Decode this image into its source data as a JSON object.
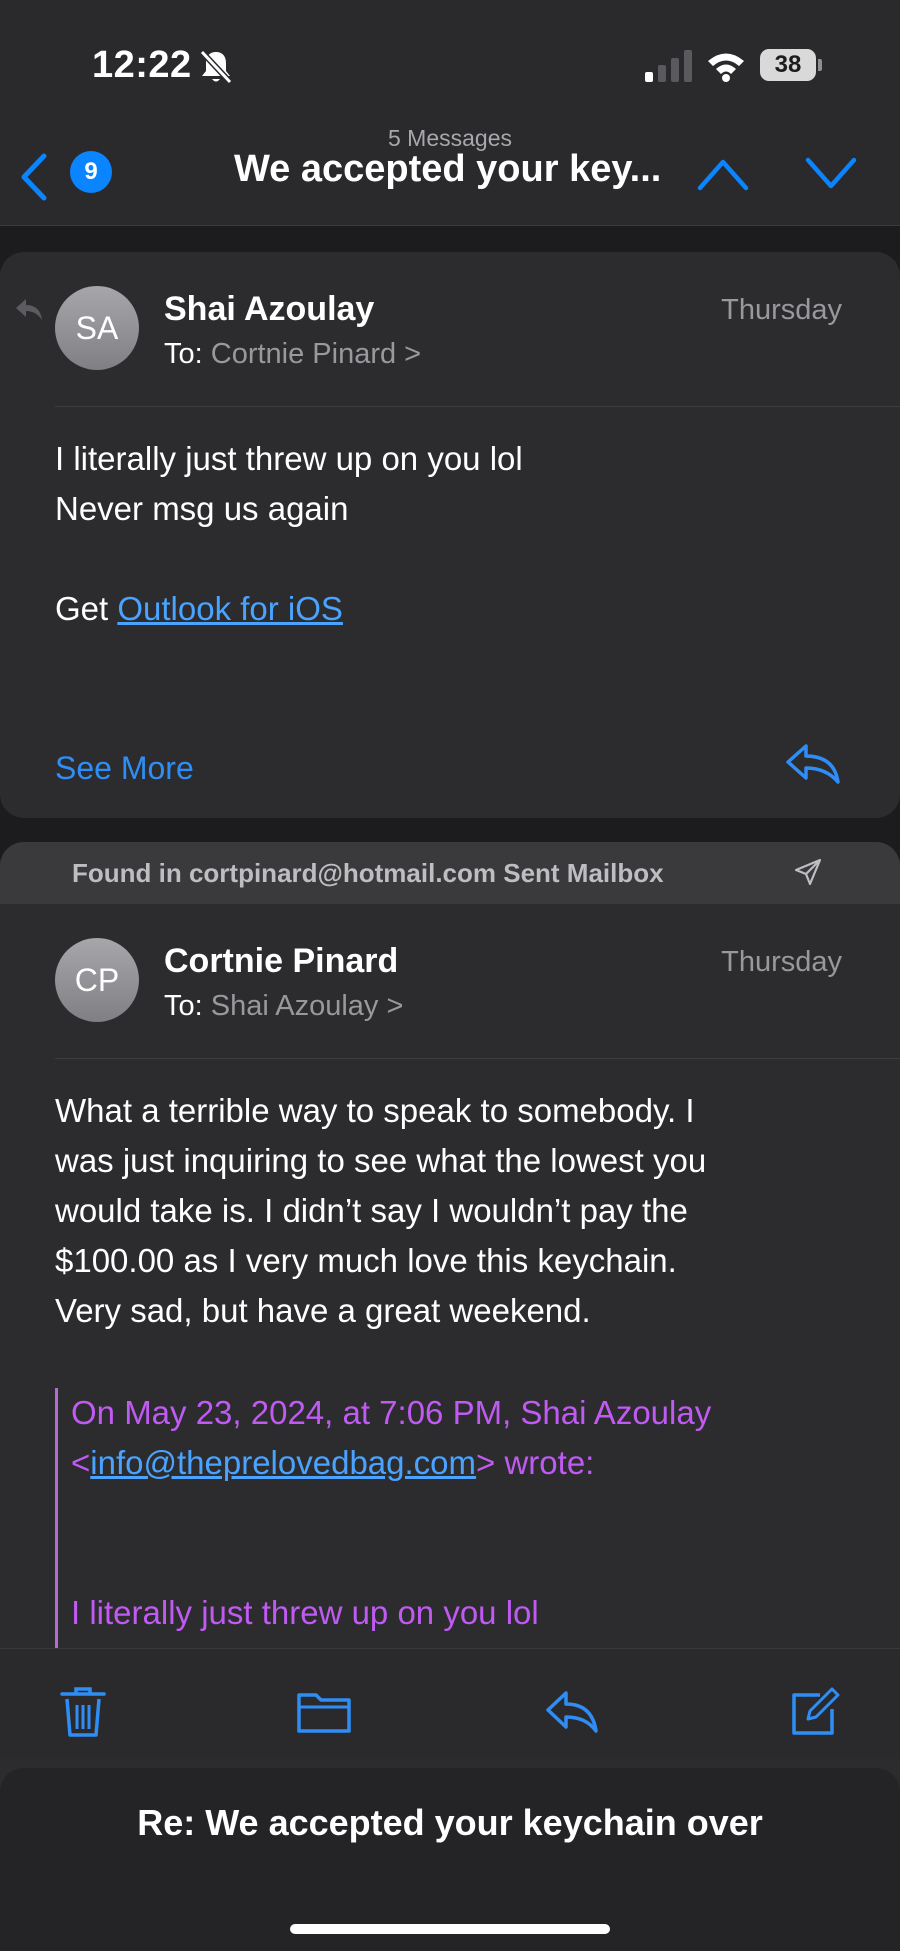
{
  "status_bar": {
    "time": "12:22",
    "battery": "38"
  },
  "nav": {
    "unread_count": "9",
    "message_count": "5 Messages",
    "title": "We accepted your key..."
  },
  "messages": [
    {
      "avatar_initials": "SA",
      "sender": "Shai Azoulay",
      "date": "Thursday",
      "to_label": "To:",
      "recipient": "Cortnie Pinard >",
      "body_lines": [
        "I literally just threw up on you lol",
        "Never msg us again"
      ],
      "signature_prefix": "Get ",
      "signature_link": "Outlook for iOS",
      "see_more": "See More"
    },
    {
      "found_in": "Found in cortpinard@hotmail.com Sent Mailbox",
      "avatar_initials": "CP",
      "sender": "Cortnie Pinard",
      "date": "Thursday",
      "to_label": "To:",
      "recipient": "Shai Azoulay >",
      "body_lines": [
        "What a terrible way to speak to somebody. I",
        "was just inquiring to see what the lowest you",
        "would take is. I didn’t say I wouldn’t pay the",
        "$100.00 as I very much love this keychain.",
        "Very sad, but have a great weekend."
      ],
      "quote_header": "On May 23, 2024, at 7:06 PM, Shai Azoulay",
      "quote_lt": "<",
      "quote_email": "info@theprelovedbag.com",
      "quote_wrote": "> wrote:",
      "quote_line": "I literally just threw up on you lol"
    }
  ],
  "draft": {
    "title": "Re: We accepted your keychain over"
  },
  "colors": {
    "accent": "#0a84ff",
    "quote": "#bf5af2",
    "background": "#1c1c1e"
  }
}
